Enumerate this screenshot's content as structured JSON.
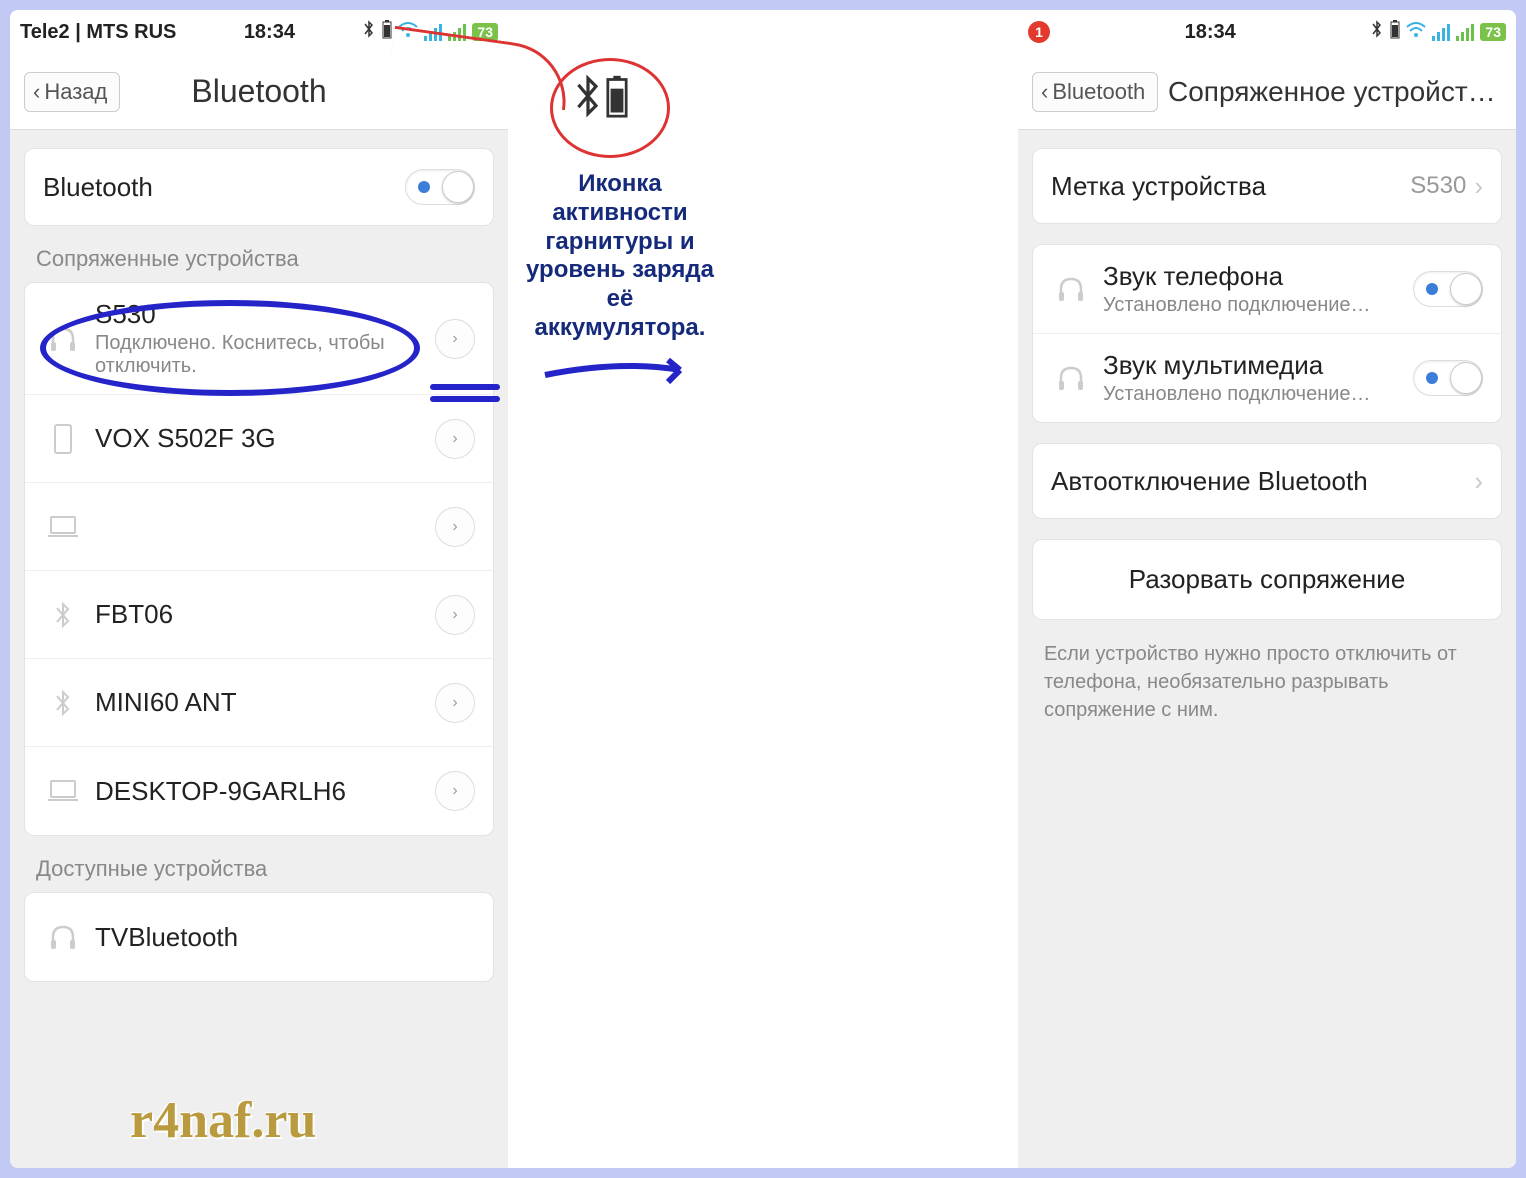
{
  "left": {
    "status": {
      "carrier": "Tele2 | MTS RUS",
      "time": "18:34",
      "battery": "73"
    },
    "back": "Назад",
    "title": "Bluetooth",
    "bt_label": "Bluetooth",
    "section_paired": "Сопряженные устройства",
    "devices": [
      {
        "name": "S530",
        "sub": "Подключено. Коснитесь, чтобы отключить.",
        "icon": "headphones"
      },
      {
        "name": "VOX S502F 3G",
        "sub": "",
        "icon": "phone"
      },
      {
        "name": "",
        "sub": "",
        "icon": "laptop"
      },
      {
        "name": "FBT06",
        "sub": "",
        "icon": "bluetooth"
      },
      {
        "name": "MINI60 ANT",
        "sub": "",
        "icon": "bluetooth"
      },
      {
        "name": "DESKTOP-9GARLH6",
        "sub": "",
        "icon": "laptop"
      }
    ],
    "section_available": "Доступные устройства",
    "available": [
      {
        "name": "TVBluetooth",
        "icon": "headphones"
      }
    ]
  },
  "right": {
    "status": {
      "time": "18:34",
      "battery": "73",
      "notif": "1"
    },
    "back": "Bluetooth",
    "title": "Сопряженное устройство...",
    "label_row": {
      "label": "Метка устройства",
      "value": "S530"
    },
    "audio": [
      {
        "name": "Звук телефона",
        "sub": "Установлено подключение…"
      },
      {
        "name": "Звук мультимедиа",
        "sub": "Установлено подключение…"
      }
    ],
    "auto_off": "Автоотключение Bluetooth",
    "unpair": "Разорвать сопряжение",
    "hint": "Если устройство нужно просто отключить от телефона, необязательно разрывать сопряжение с ним."
  },
  "annotation": "Иконка активности гарнитуры и уровень заряда её аккумулятора.",
  "watermark": "r4naf.ru"
}
